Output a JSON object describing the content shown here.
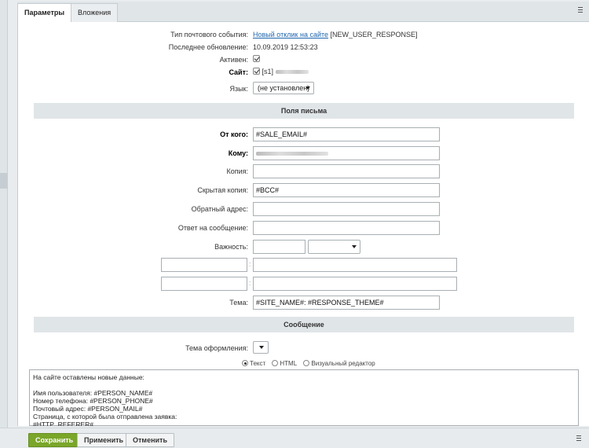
{
  "tabs": [
    "Параметры",
    "Вложения"
  ],
  "info": {
    "event_type_label": "Тип почтового события:",
    "event_type_link": "Новый отклик на сайте",
    "event_type_code": "[NEW_USER_RESPONSE]",
    "last_update_label": "Последнее обновление:",
    "last_update_value": "10.09.2019 12:53:23",
    "active_label": "Активен:",
    "site_label": "Сайт:",
    "site_value": "[s1]",
    "lang_label": "Язык:",
    "lang_value": "(не установлен)"
  },
  "section_fields": "Поля письма",
  "fields": {
    "from_label": "От кого:",
    "from_value": "#SALE_EMAIL#",
    "to_label": "Кому:",
    "cc_label": "Копия:",
    "bcc_label": "Скрытая копия:",
    "bcc_value": "#BCC#",
    "return_label": "Обратный адрес:",
    "reply_label": "Ответ на сообщение:",
    "priority_label": "Важность:",
    "subject_label": "Тема:",
    "subject_value": "#SITE_NAME#: #RESPONSE_THEME#"
  },
  "section_message": "Сообщение",
  "message": {
    "theme_label": "Тема оформления:",
    "radio_text": "Текст",
    "radio_html": "HTML",
    "radio_visual": "Визуальный редактор",
    "body": "На сайте оставлены новые данные:\n\nИмя пользователя: #PERSON_NAME#\nНомер телефона: #PERSON_PHONE#\nПочтовый адрес: #PERSON_MAIL#\nСтраница, с которой была отправлена заявка:\n#HTTP_REFERER#"
  },
  "buttons": {
    "save": "Сохранить",
    "apply": "Применить",
    "cancel": "Отменить"
  },
  "colors": {
    "accent_green": "#7aa62a",
    "link": "#2067b0"
  }
}
